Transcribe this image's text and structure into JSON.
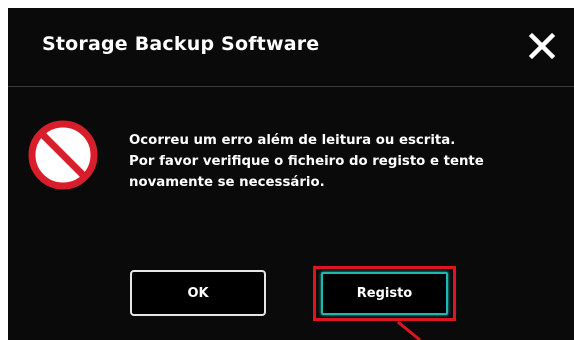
{
  "dialog": {
    "title": "Storage Backup Software",
    "close_icon": "close-icon",
    "error_icon": "prohibited-icon",
    "message_lines": [
      "Ocorreu um erro além de leitura ou escrita.",
      "Por favor verifique o ficheiro do registo e tente",
      "novamente se necessário."
    ],
    "buttons": {
      "ok_label": "OK",
      "registo_label": "Registo"
    }
  },
  "colors": {
    "background": "#0a0a0a",
    "text": "#ffffff",
    "error_red": "#d81e2a",
    "highlight_red": "#e0141e",
    "focus_cyan": "#1fb7b3"
  }
}
